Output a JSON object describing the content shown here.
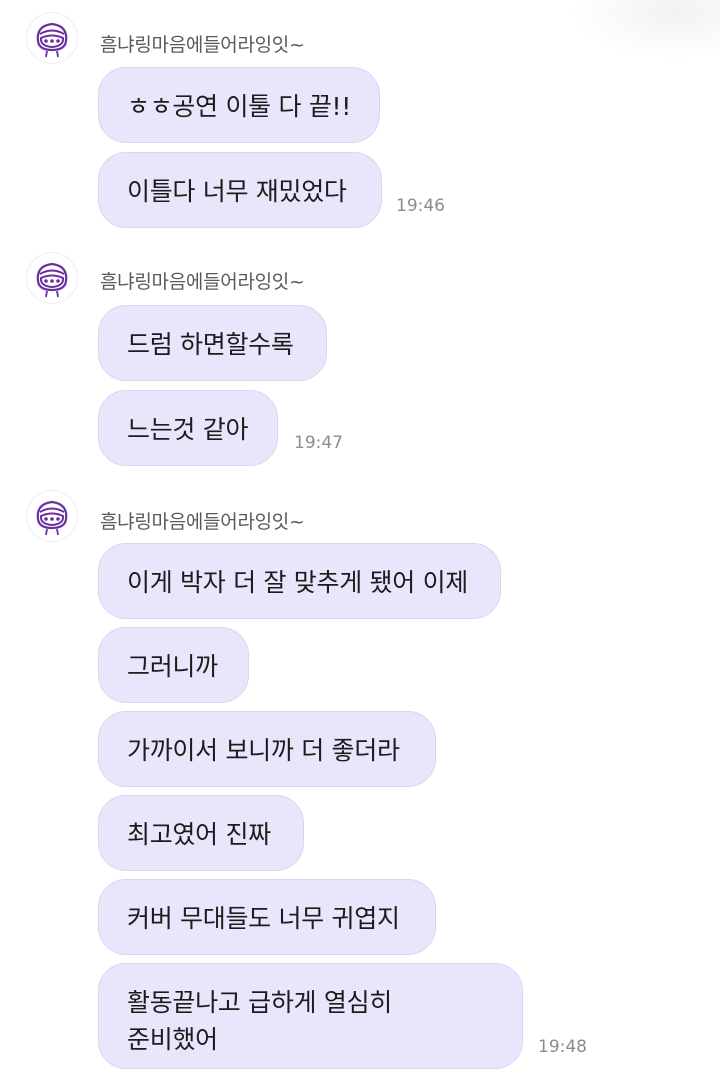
{
  "sender_name": "흠냐링마음에들어라잉잇~",
  "groups": [
    {
      "messages": [
        "ㅎㅎ공연 이툴 다 끝!!",
        "이틀다 너무 재밌었다"
      ],
      "time": "19:46"
    },
    {
      "messages": [
        "드럼 하면할수록",
        "느는것 같아"
      ],
      "time": "19:47"
    },
    {
      "messages": [
        "이게 박자 더 잘 맞추게 됐어 이제",
        "그러니까",
        "가까이서 보니까 더 좋더라",
        "최고였어 진짜",
        "커버 무대들도 너무 귀엽지",
        [
          "활동끝나고 급하게 열심히",
          "준비했어"
        ]
      ],
      "time": "19:48"
    }
  ],
  "colors": {
    "bubble_bg": "#e8e6fb",
    "avatar_accent": "#6b2fa3"
  },
  "icons": {
    "avatar": "cartoon-character-face-icon"
  }
}
